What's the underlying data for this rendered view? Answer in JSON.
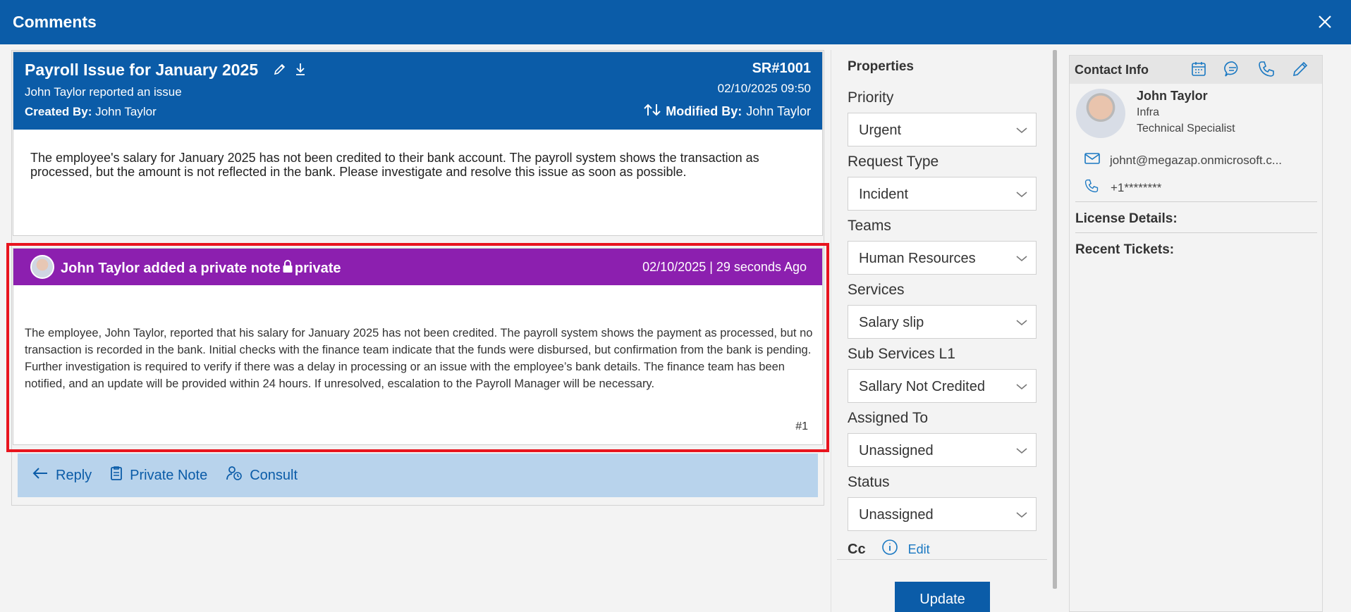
{
  "window": {
    "title": "Comments"
  },
  "ticket": {
    "title": "Payroll Issue for January 2025",
    "subtitle": "John Taylor reported an issue",
    "created_by_label": "Created By:",
    "created_by": "John Taylor",
    "sr_number": "SR#1001",
    "datetime": "02/10/2025 09:50",
    "modified_by_label": "Modified By:",
    "modified_by": "John Taylor",
    "description": "The employee's salary for January 2025 has not been credited to their bank account. The payroll system shows the transaction as processed, but the amount is not reflected in the bank. Please investigate and resolve this issue as soon as possible."
  },
  "note": {
    "title": "John Taylor added a private note",
    "private_label": "private",
    "time": "02/10/2025 | 29 seconds Ago",
    "body": "The employee, John Taylor, reported that his salary for January 2025 has not been credited. The payroll system shows the payment as processed, but no transaction is recorded in the bank. Initial checks with the finance team indicate that the funds were disbursed, but confirmation from the bank is pending. Further investigation is required to verify if there was a delay in processing or an issue with the employee’s bank details. The finance team has been notified, and an update will be provided within 24 hours. If unresolved, escalation to the Payroll Manager will be necessary.",
    "number": "#1"
  },
  "actions": {
    "reply": "Reply",
    "private_note": "Private Note",
    "consult": "Consult"
  },
  "properties": {
    "title": "Properties",
    "priority_label": "Priority",
    "priority": "Urgent",
    "request_type_label": "Request Type",
    "request_type": "Incident",
    "teams_label": "Teams",
    "teams": "Human Resources",
    "services_label": "Services",
    "services": "Salary slip",
    "sub_services_label": "Sub Services L1",
    "sub_services": "Sallary Not Credited",
    "assigned_to_label": "Assigned To",
    "assigned_to": "Unassigned",
    "status_label": "Status",
    "status": "Unassigned",
    "cc_label": "Cc",
    "edit_label": "Edit",
    "update_label": "Update"
  },
  "contact": {
    "title": "Contact Info",
    "name": "John Taylor",
    "department": "Infra",
    "role": "Technical Specialist",
    "email": "johnt@megazap.onmicrosoft.c...",
    "phone": "+1********",
    "license_label": "License Details:",
    "recent_label": "Recent Tickets:"
  },
  "colors": {
    "header_blue": "#0b5ca8",
    "note_purple": "#8c1faf",
    "highlight_red": "#e8141e",
    "action_bar": "#b8d3ec",
    "link_blue": "#1a78c2"
  }
}
